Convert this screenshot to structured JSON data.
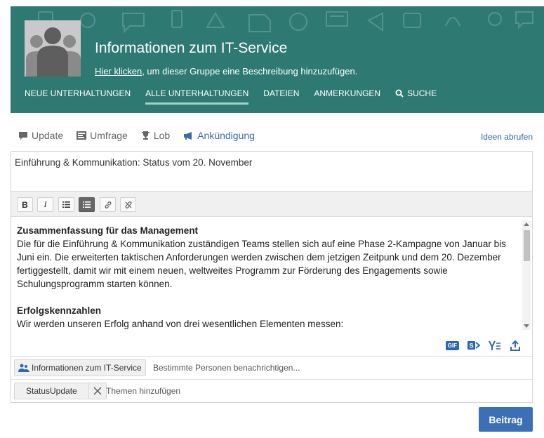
{
  "header": {
    "title": "Informationen zum IT-Service",
    "description_link": "Hier klicken",
    "description_rest": ", um dieser Gruppe eine Beschreibung hinzuzufügen.",
    "bg_color": "#2e7a73",
    "nav": [
      {
        "label": "NEUE UNTERHALTUNGEN"
      },
      {
        "label": "ALLE UNTERHALTUNGEN",
        "active": true
      },
      {
        "label": "DATEIEN"
      },
      {
        "label": "ANMERKUNGEN"
      },
      {
        "label": "SUCHE",
        "icon": "search-icon"
      }
    ]
  },
  "post_types": {
    "tabs": [
      {
        "label": "Update",
        "icon": "speech-bubble-icon"
      },
      {
        "label": "Umfrage",
        "icon": "poll-icon"
      },
      {
        "label": "Lob",
        "icon": "trophy-icon"
      },
      {
        "label": "Ankündigung",
        "icon": "megaphone-icon",
        "active": true
      }
    ],
    "ideas_link": "Ideen abrufen"
  },
  "composer": {
    "title_value": "Einführung & Kommunikation: Status vom 20. November",
    "toolbar": [
      "bold",
      "italic",
      "bulleted-list",
      "numbered-list",
      "link",
      "unlink"
    ],
    "toolbar_labels": {
      "bold": "B",
      "italic": "I"
    },
    "body": {
      "heading1": "Zusammenfassung für das Management",
      "para1": "Die für die Einführung & Kommunikation zuständigen Teams stellen sich auf eine Phase 2-Kampagne von Januar bis Juni ein. Die erweiterten taktischen Anforderungen werden zwischen dem jetzigen Zeitpunk und dem 20. Dezember fertiggestellt, damit wir mit einem neuen, weltweites Programm zur Förderung des Engagements sowie Schulungsprogramm starten können.",
      "heading2": "Erfolgskennzahlen",
      "para2": "Wir werden unseren Erfolg anhand von drei wesentlichen Elementen messen:"
    },
    "insert_icons": [
      "gif-icon",
      "sharepoint-icon",
      "yammer-icon",
      "upload-icon"
    ],
    "gif_label": "GIF",
    "group_chip": "Informationen zum IT-Service",
    "notify_placeholder": "Bestimmte Personen benachrichtigen...",
    "topic_chip": "StatusUpdate",
    "topics_placeholder": "Themen hinzufügen"
  },
  "post_button": "Beitrag",
  "accent_color": "#3b6fb6"
}
